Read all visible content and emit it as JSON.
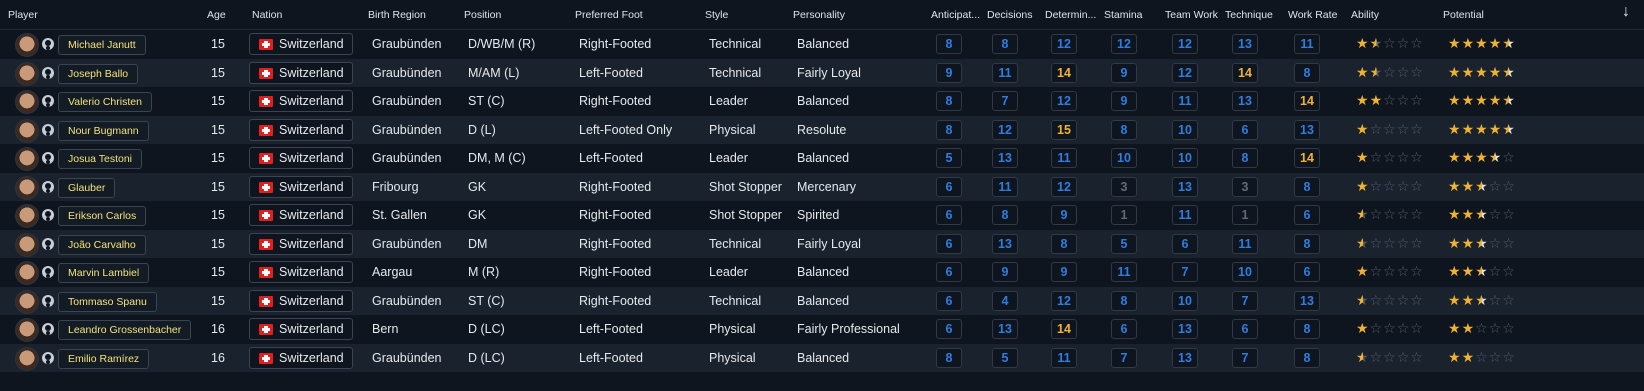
{
  "headers": {
    "player": "Player",
    "age": "Age",
    "nation": "Nation",
    "birth_region": "Birth Region",
    "position": "Position",
    "preferred_foot": "Preferred Foot",
    "style": "Style",
    "personality": "Personality",
    "anticipation": "Anticipat...",
    "decisions": "Decisions",
    "determination": "Determin...",
    "stamina": "Stamina",
    "team_work": "Team Work",
    "technique": "Technique",
    "work_rate": "Work Rate",
    "ability": "Ability",
    "potential": "Potential",
    "sort_icon": "arrow-down-icon"
  },
  "attribute_colors": {
    "low": "#5f6b7a",
    "mid": "#2f7de1",
    "high": "#3f8dff",
    "good": "#f0b331"
  },
  "rows": [
    {
      "name": "Michael Janutt",
      "age": "15",
      "nation": "Switzerland",
      "region": "Graubünden",
      "position": "D/WB/M (R)",
      "foot": "Right-Footed",
      "style": "Technical",
      "personality": "Balanced",
      "attrs": [
        8,
        8,
        12,
        12,
        12,
        13,
        11
      ],
      "ability": 1.5,
      "potential": 4.5
    },
    {
      "name": "Joseph Ballo",
      "age": "15",
      "nation": "Switzerland",
      "region": "Graubünden",
      "position": "M/AM (L)",
      "foot": "Left-Footed",
      "style": "Technical",
      "personality": "Fairly Loyal",
      "attrs": [
        9,
        11,
        14,
        9,
        12,
        14,
        8
      ],
      "ability": 1.5,
      "potential": 4.5
    },
    {
      "name": "Valerio Christen",
      "age": "15",
      "nation": "Switzerland",
      "region": "Graubünden",
      "position": "ST (C)",
      "foot": "Right-Footed",
      "style": "Leader",
      "personality": "Balanced",
      "attrs": [
        8,
        7,
        12,
        9,
        11,
        13,
        14
      ],
      "ability": 2,
      "potential": 4.5
    },
    {
      "name": "Nour Bugmann",
      "age": "15",
      "nation": "Switzerland",
      "region": "Graubünden",
      "position": "D (L)",
      "foot": "Left-Footed Only",
      "style": "Physical",
      "personality": "Resolute",
      "attrs": [
        8,
        12,
        15,
        8,
        10,
        6,
        13
      ],
      "ability": 1,
      "potential": 4.5
    },
    {
      "name": "Josua Testoni",
      "age": "15",
      "nation": "Switzerland",
      "region": "Graubünden",
      "position": "DM, M (C)",
      "foot": "Left-Footed",
      "style": "Leader",
      "personality": "Balanced",
      "attrs": [
        5,
        13,
        11,
        10,
        10,
        8,
        14
      ],
      "ability": 1,
      "potential": 3.5
    },
    {
      "name": "Glauber",
      "age": "15",
      "nation": "Switzerland",
      "region": "Fribourg",
      "position": "GK",
      "foot": "Right-Footed",
      "style": "Shot Stopper",
      "personality": "Mercenary",
      "attrs": [
        6,
        11,
        12,
        3,
        13,
        3,
        8
      ],
      "ability": 1,
      "potential": 2.5
    },
    {
      "name": "Erikson Carlos",
      "age": "15",
      "nation": "Switzerland",
      "region": "St. Gallen",
      "position": "GK",
      "foot": "Right-Footed",
      "style": "Shot Stopper",
      "personality": "Spirited",
      "attrs": [
        6,
        8,
        9,
        1,
        11,
        1,
        6
      ],
      "ability": 0.5,
      "potential": 2.5
    },
    {
      "name": "João Carvalho",
      "age": "15",
      "nation": "Switzerland",
      "region": "Graubünden",
      "position": "DM",
      "foot": "Right-Footed",
      "style": "Technical",
      "personality": "Fairly Loyal",
      "attrs": [
        6,
        13,
        8,
        5,
        6,
        11,
        8
      ],
      "ability": 0.5,
      "potential": 2.5
    },
    {
      "name": "Marvin Lambiel",
      "age": "15",
      "nation": "Switzerland",
      "region": "Aargau",
      "position": "M (R)",
      "foot": "Right-Footed",
      "style": "Leader",
      "personality": "Balanced",
      "attrs": [
        6,
        9,
        9,
        11,
        7,
        10,
        6
      ],
      "ability": 1,
      "potential": 2.5
    },
    {
      "name": "Tommaso Spanu",
      "age": "15",
      "nation": "Switzerland",
      "region": "Graubünden",
      "position": "ST (C)",
      "foot": "Right-Footed",
      "style": "Technical",
      "personality": "Balanced",
      "attrs": [
        6,
        4,
        12,
        8,
        10,
        7,
        13
      ],
      "ability": 0.5,
      "potential": 2.5
    },
    {
      "name": "Leandro Grossenbacher",
      "age": "16",
      "nation": "Switzerland",
      "region": "Bern",
      "position": "D (LC)",
      "foot": "Left-Footed",
      "style": "Physical",
      "personality": "Fairly Professional",
      "attrs": [
        6,
        13,
        14,
        6,
        13,
        6,
        8
      ],
      "ability": 1,
      "potential": 2
    },
    {
      "name": "Emilio Ramírez",
      "age": "16",
      "nation": "Switzerland",
      "region": "Graubünden",
      "position": "D (LC)",
      "foot": "Left-Footed",
      "style": "Physical",
      "personality": "Balanced",
      "attrs": [
        8,
        5,
        11,
        7,
        13,
        7,
        8
      ],
      "ability": 0.5,
      "potential": 2
    }
  ]
}
